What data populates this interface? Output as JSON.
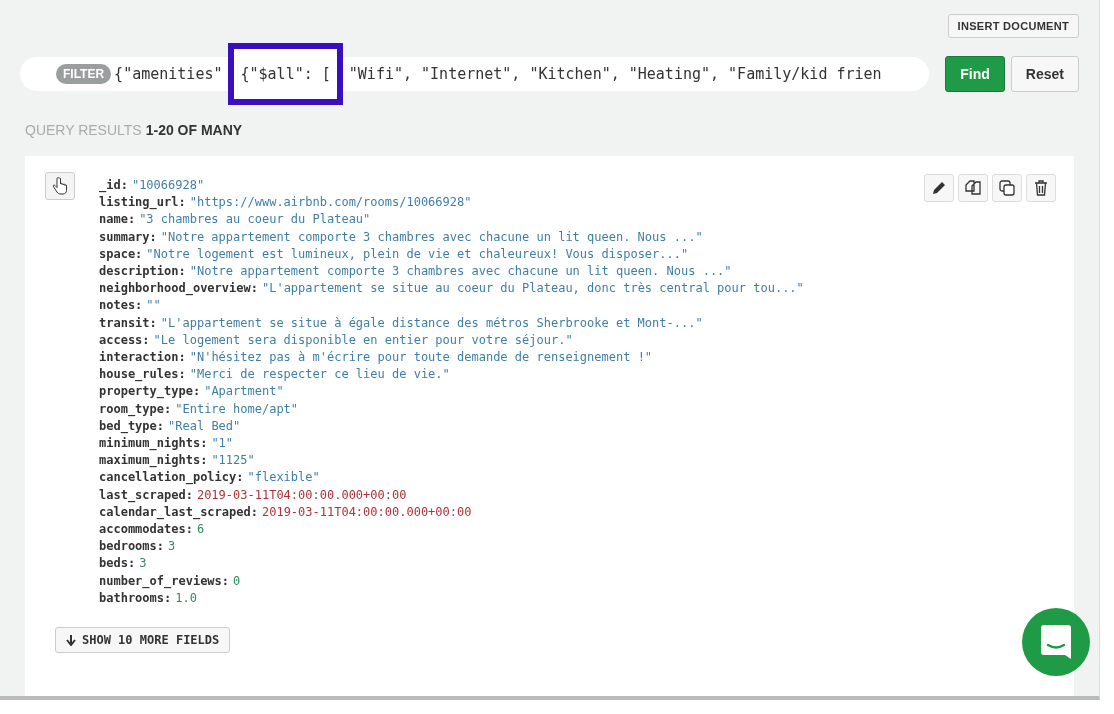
{
  "toolbar": {
    "insert_button": "INSERT DOCUMENT"
  },
  "filter": {
    "label": "FILTER",
    "segments": [
      {
        "text": "{\"amenities\"",
        "highlighted": false
      },
      {
        "text": "{\"$all\": [",
        "highlighted": true
      },
      {
        "text": "\"Wifi\", \"Internet\", \"Kitchen\", \"Heating\", \"Family/kid frien",
        "highlighted": false
      }
    ]
  },
  "buttons": {
    "find": "Find",
    "reset": "Reset"
  },
  "results": {
    "label": "QUERY RESULTS",
    "range": "1-20 OF MANY"
  },
  "document": {
    "fields": [
      {
        "key": "_id:",
        "value": "\"10066928\"",
        "kind": "string"
      },
      {
        "key": "listing_url:",
        "value": "\"https://www.airbnb.com/rooms/10066928\"",
        "kind": "string"
      },
      {
        "key": "name:",
        "value": "\"3 chambres au coeur du Plateau\"",
        "kind": "string"
      },
      {
        "key": "summary:",
        "value": "\"Notre appartement comporte 3 chambres avec chacune un lit queen. Nous ...\"",
        "kind": "string"
      },
      {
        "key": "space:",
        "value": "\"Notre logement est lumineux, plein de vie et chaleureux! Vous disposer...\"",
        "kind": "string"
      },
      {
        "key": "description:",
        "value": "\"Notre appartement comporte 3 chambres avec chacune un lit queen. Nous ...\"",
        "kind": "string"
      },
      {
        "key": "neighborhood_overview:",
        "value": "\"L'appartement se situe au coeur du Plateau, donc très central pour tou...\"",
        "kind": "string"
      },
      {
        "key": "notes:",
        "value": "\"\"",
        "kind": "string"
      },
      {
        "key": "transit:",
        "value": "\"L'appartement se situe à égale distance des métros Sherbrooke et Mont-...\"",
        "kind": "string"
      },
      {
        "key": "access:",
        "value": "\"Le logement sera disponible en entier pour votre séjour.\"",
        "kind": "string"
      },
      {
        "key": "interaction:",
        "value": "\"N'hésitez pas à m'écrire pour toute demande de renseignement !\"",
        "kind": "string"
      },
      {
        "key": "house_rules:",
        "value": "\"Merci de respecter ce lieu de vie.\"",
        "kind": "string"
      },
      {
        "key": "property_type:",
        "value": "\"Apartment\"",
        "kind": "string"
      },
      {
        "key": "room_type:",
        "value": "\"Entire home/apt\"",
        "kind": "string"
      },
      {
        "key": "bed_type:",
        "value": "\"Real Bed\"",
        "kind": "string"
      },
      {
        "key": "minimum_nights:",
        "value": "\"1\"",
        "kind": "string"
      },
      {
        "key": "maximum_nights:",
        "value": "\"1125\"",
        "kind": "string"
      },
      {
        "key": "cancellation_policy:",
        "value": "\"flexible\"",
        "kind": "string"
      },
      {
        "key": "last_scraped:",
        "value": "2019-03-11T04:00:00.000+00:00",
        "kind": "date"
      },
      {
        "key": "calendar_last_scraped:",
        "value": "2019-03-11T04:00:00.000+00:00",
        "kind": "date"
      },
      {
        "key": "accommodates:",
        "value": "6",
        "kind": "number"
      },
      {
        "key": "bedrooms:",
        "value": "3",
        "kind": "number"
      },
      {
        "key": "beds:",
        "value": "3",
        "kind": "number"
      },
      {
        "key": "number_of_reviews:",
        "value": "0",
        "kind": "number"
      },
      {
        "key": "bathrooms:",
        "value": "1.0",
        "kind": "number"
      }
    ],
    "more_button": "SHOW 10 MORE FIELDS"
  }
}
